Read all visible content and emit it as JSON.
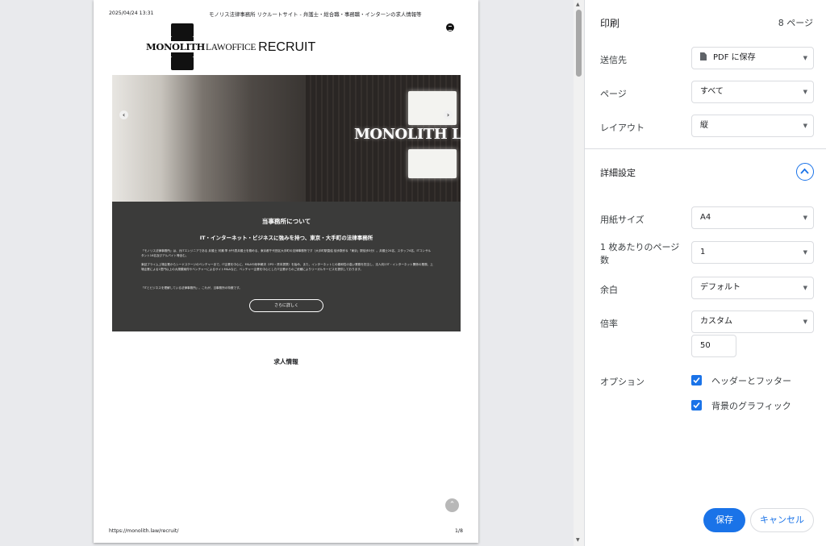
{
  "preview": {
    "header_date": "2025/04/24 13:31",
    "header_title": "モノリス法律事務所 リクルートサイト - 弁護士・総合職・事務職・インターンの求人情報等",
    "logo": {
      "monolith": "MONOLITH",
      "lawoffice": "LAWOFFICE",
      "recruit": "RECRUIT"
    },
    "hero_sign_text": "MONOLITH L",
    "about": {
      "heading": "当事務所について",
      "subheading": "IT・インターネット・ビジネスに強みを持つ、東京・大手町の法律事務所",
      "para1": "「モノリス法律事務所」は、元ITエンジニアである 弁護士 河瀬 季 が代表弁護士を務める、東京都千代田区大手町の法律事務所です（大手町駅直結 徒歩数秒＆「東京」駅徒歩3分）。弁護士24名、スタッフ4名、ITコンサルタント16名及びアルバイト等含む。",
      "para2": "東証プライム上場企業からシードステージのベンチャーまで、IT企業を中心に、M&Aや紛争解決（IPO・資本提携）を始め、また、インターネットとの親和性の高い業務を担当し、法人向けIT・インターネット関係の業務、上場企業による1億円以上の大規模案件やベンチャーによるサイトM&Aなど、ベンチャー企業を中心としたIT企業からのご依頼によりリーガルサービスを提供しております。",
      "para3": "「ITとビジネスを理解している法律事務所」。これが、当事務所の特徴です。",
      "button": "さらに詳しく"
    },
    "jobs_heading": "求人情報",
    "footer_url": "https://monolith.law/recruit/",
    "footer_page": "1/8"
  },
  "panel": {
    "title": "印刷",
    "page_count": "8 ページ",
    "destination": {
      "label": "送信先",
      "value": "PDF に保存"
    },
    "pages": {
      "label": "ページ",
      "value": "すべて"
    },
    "layout": {
      "label": "レイアウト",
      "value": "縦"
    },
    "advanced": {
      "label": "詳細設定"
    },
    "paper_size": {
      "label": "用紙サイズ",
      "value": "A4"
    },
    "pages_per_sheet": {
      "label_line1": "1 枚あたりのページ",
      "label_line2": "数",
      "value": "1"
    },
    "margins": {
      "label": "余白",
      "value": "デフォルト"
    },
    "scale": {
      "label": "倍率",
      "value": "カスタム",
      "custom_value": "50"
    },
    "options": {
      "label": "オプション",
      "headers_footers": "ヘッダーとフッター",
      "background_graphics": "背景のグラフィック"
    },
    "save_button": "保存",
    "cancel_button": "キャンセル"
  },
  "colors": {
    "accent": "#1a73e8",
    "about_bg": "#3b3b3a"
  }
}
